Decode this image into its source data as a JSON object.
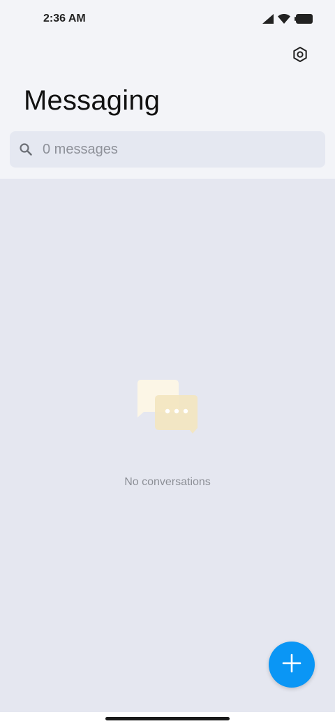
{
  "status_bar": {
    "time": "2:36 AM",
    "icons": [
      "cell-signal-icon",
      "wifi-icon",
      "battery-icon"
    ]
  },
  "header": {
    "title": "Messaging",
    "settings_icon": "settings-icon"
  },
  "search": {
    "placeholder": "0 messages",
    "icon": "search-icon"
  },
  "empty_state": {
    "icon": "chat-bubbles-icon",
    "text": "No conversations"
  },
  "fab": {
    "icon": "plus-icon",
    "color": "#0a96f5"
  },
  "colors": {
    "background": "#f3f4f8",
    "list_background": "#e5e7f0",
    "search_background": "#e5e8f1",
    "accent": "#0a96f5"
  }
}
